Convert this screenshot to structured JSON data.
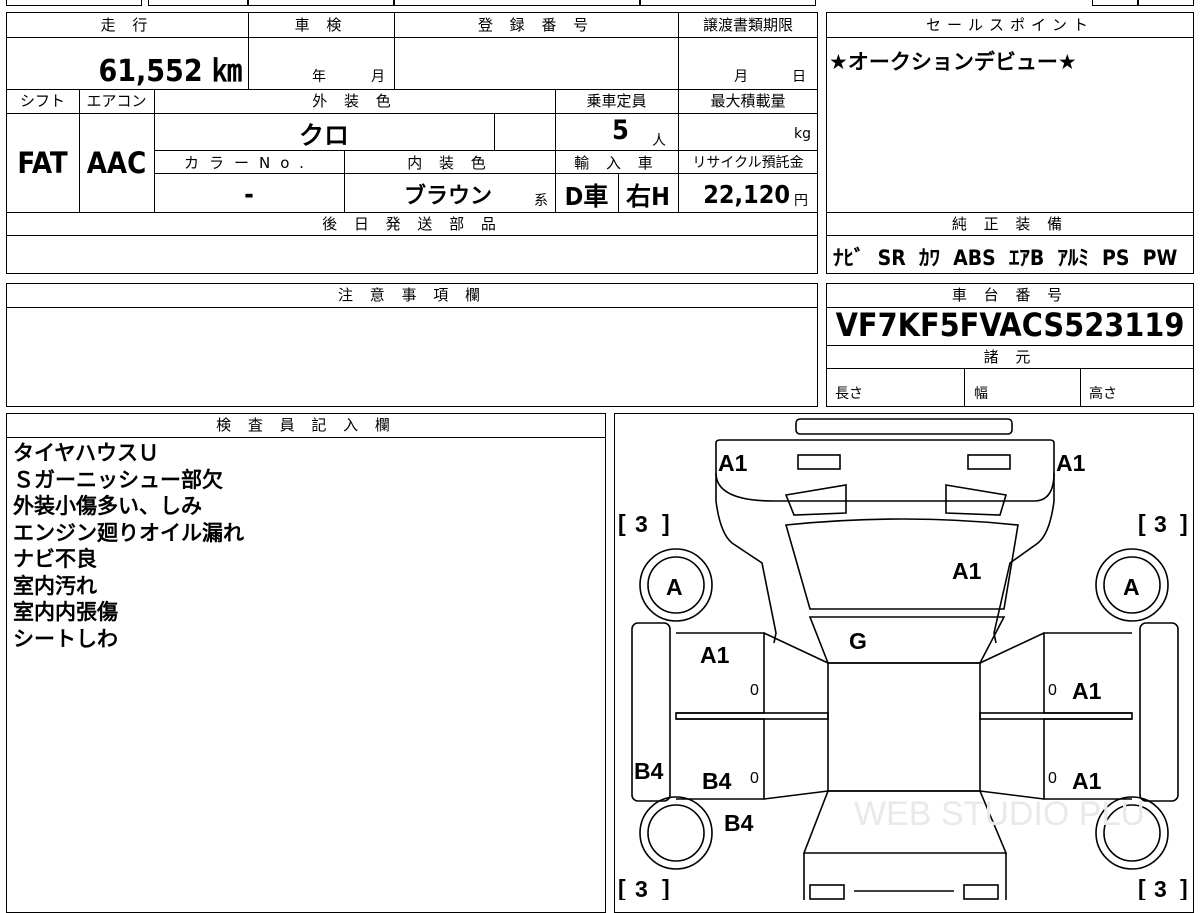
{
  "headers": {
    "mileage": "走 行",
    "inspection": "車 検",
    "registration": "登 録 番 号",
    "transfer_deadline": "譲渡書類期限",
    "sales_point": "セールスポイント",
    "shift": "シフト",
    "aircon": "エアコン",
    "exterior_color": "外 装 色",
    "capacity": "乗車定員",
    "max_load": "最大積載量",
    "color_no": "カラーNo.",
    "interior_color": "内 装 色",
    "import": "輸 入 車",
    "recycle": "リサイクル預託金",
    "later_parts": "後 日 発 送 部 品",
    "genuine_equipment": "純 正 装 備",
    "notes": "注 意 事 項 欄",
    "chassis_no": "車 台 番 号",
    "specs": "諸 元",
    "inspector": "検 査 員 記 入 欄"
  },
  "values": {
    "mileage": "61,552 ㎞",
    "inspection_year": "年",
    "inspection_month": "月",
    "transfer_month": "月",
    "transfer_day": "日",
    "sales_point": "★オークションデビュー★",
    "shift": "FAT",
    "aircon": "AAC",
    "exterior_color": "クロ",
    "capacity": "5",
    "capacity_unit": "人",
    "load_unit": "kg",
    "color_no": "-",
    "interior_color": "ブラウン",
    "interior_suffix": "系",
    "import_drive": "D車",
    "import_handle": "右H",
    "recycle_fee": "22,120",
    "recycle_unit": "円",
    "genuine_equipment": "ﾅﾋﾞ  SR  ｶﾜ  ABS  ｴｱB  ｱﾙﾐ  PS  PW",
    "chassis_no": "VF7KF5FVACS523119",
    "length_label": "長さ",
    "width_label": "幅",
    "height_label": "高さ"
  },
  "inspector_notes": [
    "タイヤハウスＵ",
    "Ｓガーニッシュー部欠",
    "外装小傷多い、しみ",
    "エンジン廻りオイル漏れ",
    "ナビ不良",
    "室内汚れ",
    "室内内張傷",
    "シートしわ"
  ],
  "diagram": {
    "marks": {
      "front_left_corner": "A1",
      "front_right_corner": "A1",
      "tire_front_left_grade": "3",
      "tire_front_right_grade": "3",
      "tire_rear_left_grade": "3",
      "tire_rear_right_grade": "3",
      "hood": "A1",
      "wheel_front_left": "A",
      "wheel_front_right": "A",
      "windshield": "G",
      "front_door_left": "A1",
      "front_door_right": "A1",
      "rear_door_left": "B4",
      "rear_door_right": "A1",
      "left_side_rear": "B4",
      "left_rear_fender": "B4",
      "door_zero_1": "0",
      "door_zero_2": "0",
      "door_zero_3": "0",
      "door_zero_4": "0"
    },
    "watermark": "WEB STUDIO PLU"
  }
}
